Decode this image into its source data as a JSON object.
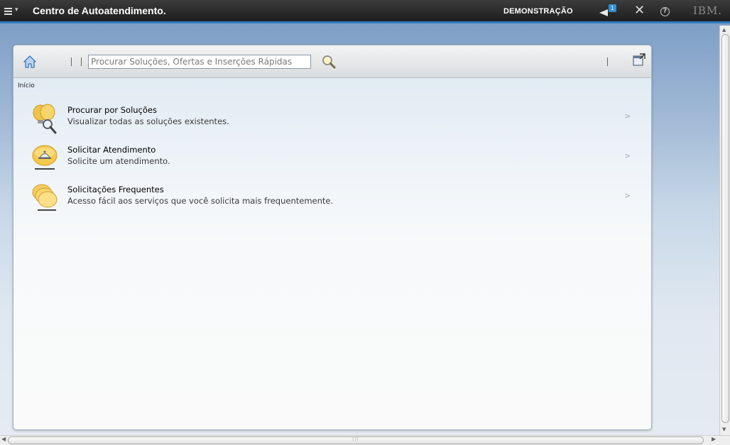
{
  "topbar": {
    "title": "Centro de Autoatendimento.",
    "mode": "DEMONSTRAÇÃO",
    "notification_count": "1",
    "brand": "IBM."
  },
  "toolbar": {
    "search_placeholder": "Procurar Soluções, Ofertas e Inserções Rápidas"
  },
  "breadcrumb": "Início",
  "items": [
    {
      "title": "Procurar por Soluções",
      "description": "Visualizar todas as soluções existentes.",
      "chevron": ">",
      "icon": "lightbulbs-search-icon"
    },
    {
      "title": "Solicitar Atendimento",
      "description": "Solicite um atendimento.",
      "chevron": ">",
      "icon": "service-bell-icon"
    },
    {
      "title": "Solicitações Frequentes",
      "description": "Acesso fácil aos serviços que você solicita mais frequentemente.",
      "chevron": ">",
      "icon": "stacked-requests-icon"
    }
  ],
  "colors": {
    "accent": "#2f7bbf",
    "icon_yellow": "#f5c84a"
  }
}
